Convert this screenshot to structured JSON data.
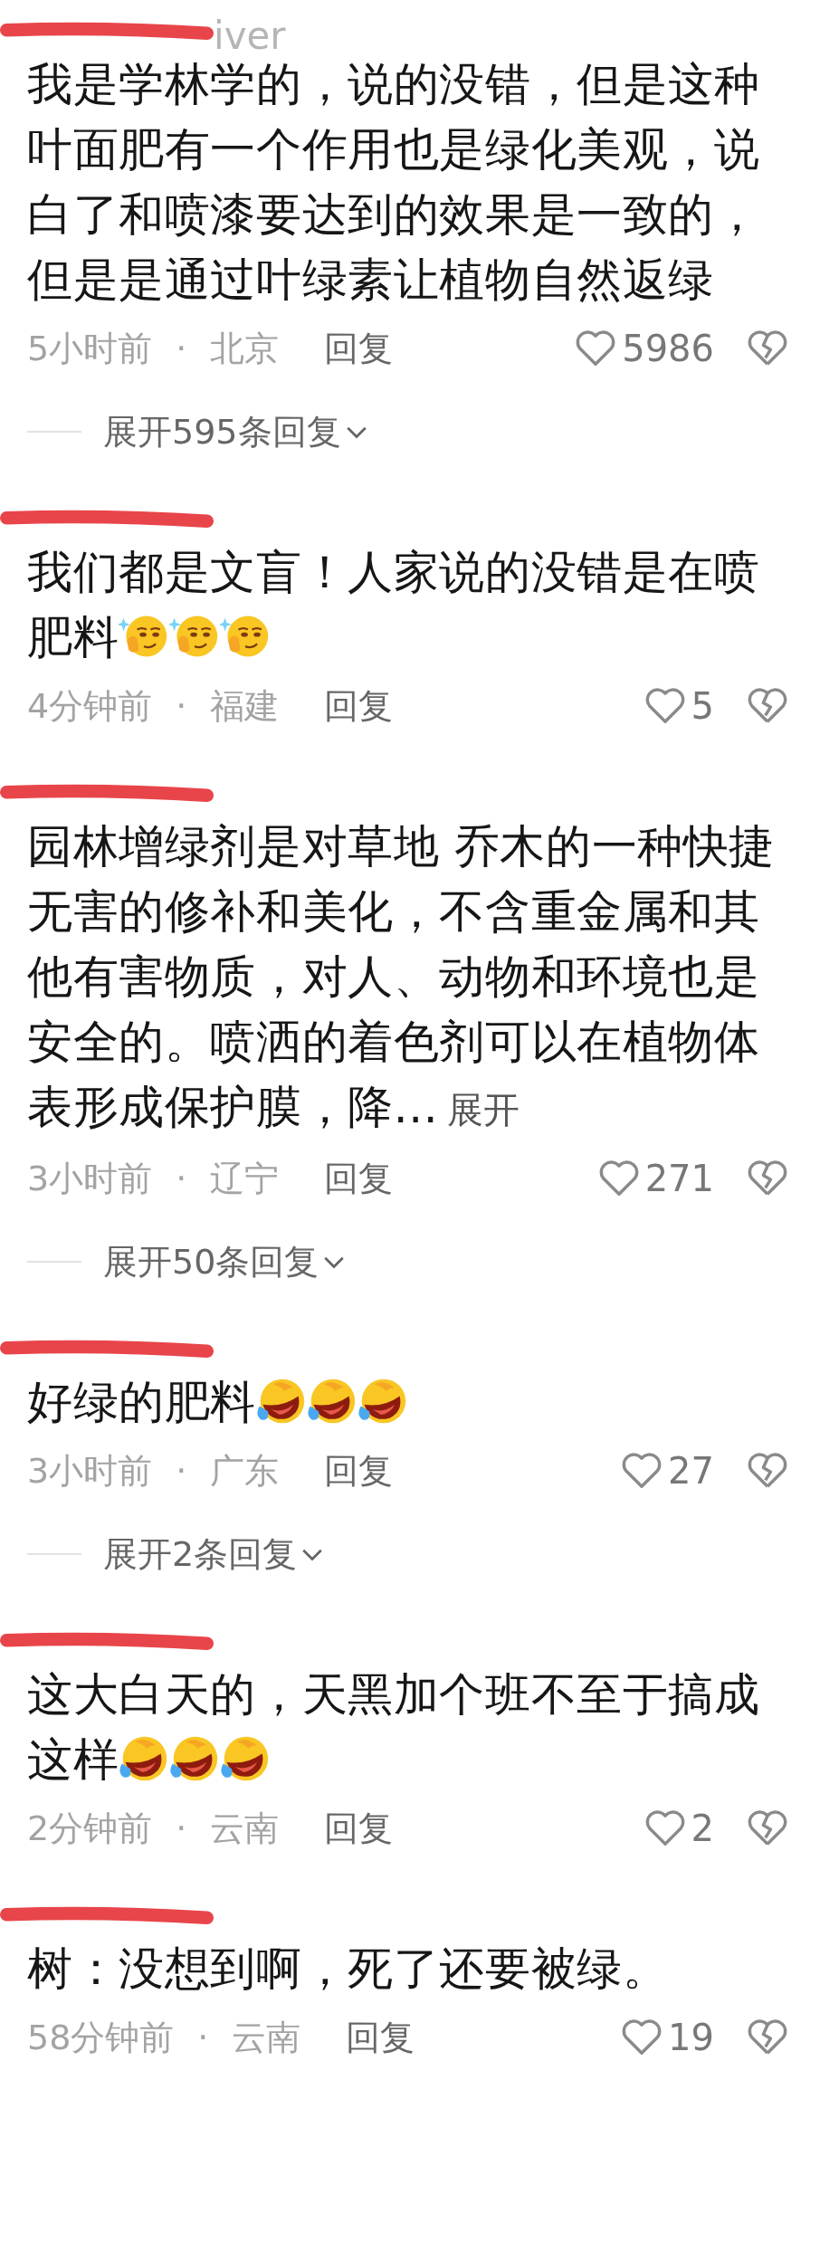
{
  "comments": [
    {
      "username": "iver",
      "redacted": true,
      "lines": [
        "我是学林学的，说的没错，但是这种",
        "叶面肥有一个作用也是绿化美观，说",
        "白了和喷漆要达到的效果是一致的，",
        "但是是通过叶绿素让植物自然返绿"
      ],
      "time": "5小时前",
      "separator": "·",
      "location": "北京",
      "reply": "回复",
      "likes": "5986",
      "expand": "展开595条回复"
    },
    {
      "redacted": true,
      "lines": [
        "我们都是文盲！人家说的没错是在喷",
        "肥料"
      ],
      "emojis": [
        {
          "kind": "smirk"
        },
        {
          "kind": "smirk"
        },
        {
          "kind": "smirk"
        }
      ],
      "time": "4分钟前",
      "separator": "·",
      "location": "福建",
      "reply": "回复",
      "likes": "5"
    },
    {
      "redacted": true,
      "lines": [
        "园林增绿剂是对草地 乔木的一种快捷",
        "无害的修补和美化，不含重金属和其",
        "他有害物质，对人、动物和环境也是",
        "安全的。喷洒的着色剂可以在植物体",
        "表形成保护膜，降..."
      ],
      "more": "展开",
      "time": "3小时前",
      "separator": "·",
      "location": "辽宁",
      "reply": "回复",
      "likes": "271",
      "expand": "展开50条回复"
    },
    {
      "redacted": true,
      "lines": [
        "好绿的肥料"
      ],
      "emojis": [
        {
          "kind": "laugh-cry"
        },
        {
          "kind": "laugh-cry"
        },
        {
          "kind": "laugh-cry"
        }
      ],
      "time": "3小时前",
      "separator": "·",
      "location": "广东",
      "reply": "回复",
      "likes": "27",
      "expand": "展开2条回复"
    },
    {
      "redacted": true,
      "lines": [
        "这大白天的，天黑加个班不至于搞成",
        "这样"
      ],
      "emojis": [
        {
          "kind": "laugh-cry"
        },
        {
          "kind": "laugh-cry"
        },
        {
          "kind": "laugh-cry"
        }
      ],
      "time": "2分钟前",
      "separator": "·",
      "location": "云南",
      "reply": "回复",
      "likes": "2"
    },
    {
      "redacted": true,
      "lines": [
        "树：没想到啊，死了还要被绿。"
      ],
      "time": "58分钟前",
      "separator": "·",
      "location": "云南",
      "reply": "回复",
      "likes": "19"
    }
  ]
}
